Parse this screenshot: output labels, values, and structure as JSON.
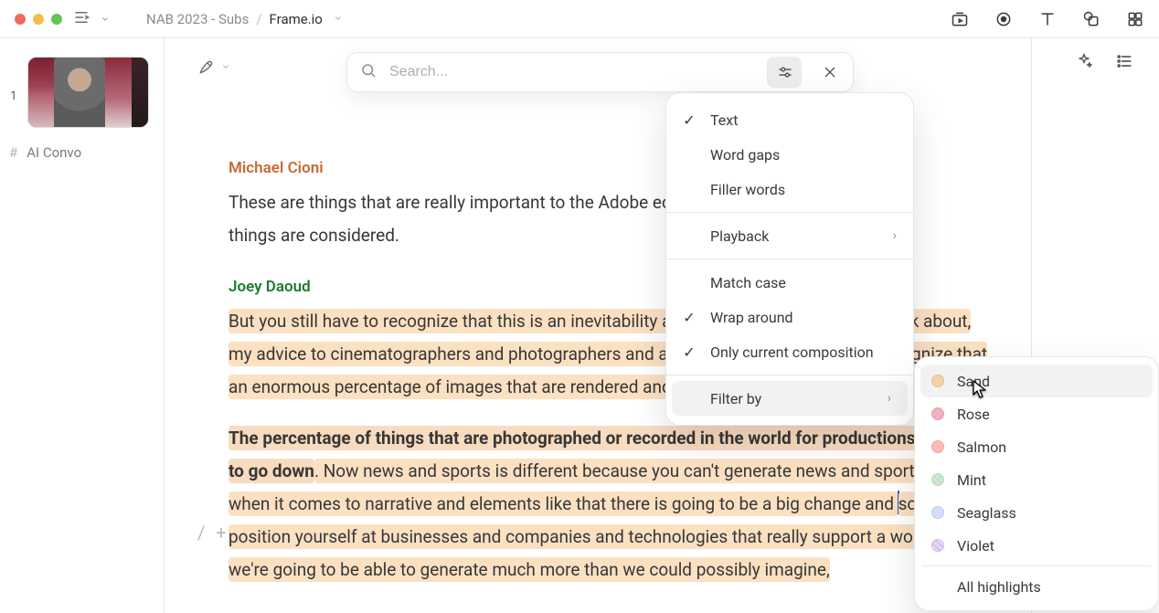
{
  "titlebar": {
    "crumb_parent": "NAB 2023 - Subs",
    "crumb_sep": "/",
    "crumb_current": "Frame.io"
  },
  "search": {
    "placeholder": "Search..."
  },
  "sidebar": {
    "clip_num": "1",
    "hash": "#",
    "clip_label": "AI Convo"
  },
  "transcript": [
    {
      "speaker": "Michael Cioni",
      "text": "These are things that are really important to the Adobe ecosystem, so all of these things are considered."
    },
    {
      "speaker": "Joey Daoud",
      "text": "But you still have to recognize that this is an inevitability and as Adobe kind of has to think about, my advice to cinematographers and photographers and artists in general, is to really recognize that an enormous percentage of images that are rendered and recorded is going to go down."
    },
    {
      "bold": "The percentage of things that are photographed or recorded in the world for productions is going to go down",
      "text1": ". Now news and sports is different because you can't generate news and sports, but when it comes to narrative and elements like that there is going to be a big change and ",
      "text2": "so you want position yourself at businesses and companies and technologies that really support a world where we're going to be able to generate much more than we could possibly imagine,"
    }
  ],
  "dropdown": [
    {
      "label": "Text",
      "checked": true
    },
    {
      "label": "Word gaps",
      "checked": false
    },
    {
      "label": "Filler words",
      "checked": false
    },
    {
      "label": "Playback",
      "submenu": true
    },
    {
      "label": "Match case",
      "checked": false
    },
    {
      "label": "Wrap around",
      "checked": true
    },
    {
      "label": "Only current composition",
      "checked": true
    },
    {
      "label": "Filter by",
      "submenu": true,
      "selected": true
    }
  ],
  "submenu": [
    {
      "label": "Sand",
      "color": "#f5d3a7",
      "hover": true
    },
    {
      "label": "Rose",
      "color": "#f2b6c4"
    },
    {
      "label": "Salmon",
      "color": "#f8bdb6"
    },
    {
      "label": "Mint",
      "color": "#cfe8d0"
    },
    {
      "label": "Seaglass",
      "color": "#cfe0f7"
    },
    {
      "label": "Violet",
      "color": "#e6d8f7"
    },
    {
      "label": "All highlights"
    }
  ]
}
